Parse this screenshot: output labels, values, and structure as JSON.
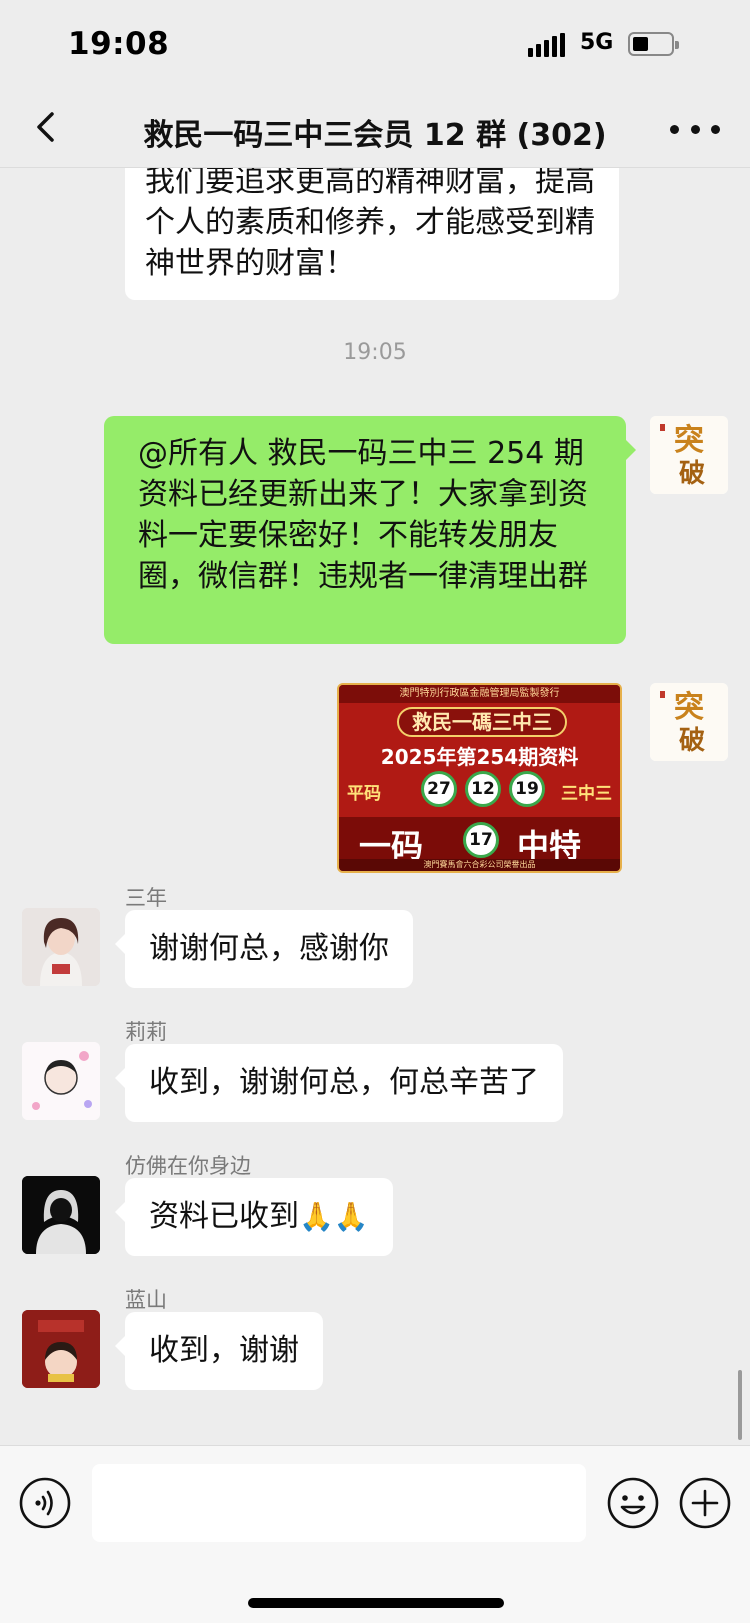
{
  "status_bar": {
    "time": "19:08",
    "network": "5G",
    "battery_level": 0.4
  },
  "nav": {
    "title": "救民一码三中三会员 12 群 (302)"
  },
  "messages": {
    "partial_text": "物质上的东西都基本上能满足了，我们要追求更高的精神财富，提高个人的素质和修养，才能感受到精神世界的财富！",
    "timestamp": "19:05",
    "own_text": "@所有人 救民一码三中三 254 期资料已经更新出来了！大家拿到资料一定要保密好！不能转发朋友圈，微信群！违规者一律清理出群",
    "lottery": {
      "header": "澳門特別行政區金融管理局監製發行",
      "banner": "救民一碼三中三",
      "period": "2025年第254期资料",
      "flat_label": "平码",
      "balls": [
        "27",
        "12",
        "19"
      ],
      "three_label": "三中三",
      "one_label": "一码",
      "special_ball": "17",
      "special_label": "中特",
      "footer": "澳門賽馬會六合彩公司榮譽出品"
    },
    "list": [
      {
        "sender": "三年",
        "text": "谢谢何总，感谢你"
      },
      {
        "sender": "莉莉",
        "text": "收到，谢谢何总，何总辛苦了"
      },
      {
        "sender": "仿佛在你身边",
        "text": "资料已收到",
        "emoji": "🙏🙏"
      },
      {
        "sender": "蓝山",
        "text": "收到，谢谢"
      }
    ]
  },
  "input": {
    "placeholder": ""
  },
  "icons": {
    "back": "chevron-left-icon",
    "more": "more-icon",
    "voice": "voice-icon",
    "emoji": "emoji-icon",
    "add": "plus-icon"
  },
  "colors": {
    "own_bubble": "#95ec69",
    "other_bubble": "#ffffff",
    "background": "#ededed"
  }
}
